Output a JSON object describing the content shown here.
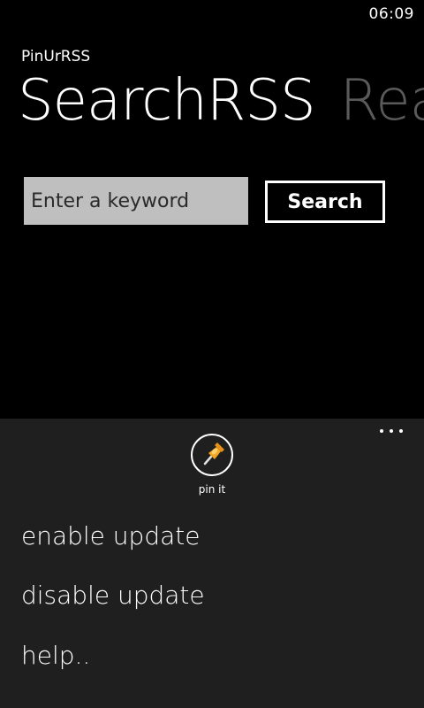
{
  "status_bar": {
    "time": "06:09"
  },
  "app": {
    "title": "PinUrRSS"
  },
  "pivot": {
    "active": "SearchRSS",
    "next": "Rea"
  },
  "search": {
    "placeholder": "Enter a keyword",
    "button_label": "Search"
  },
  "app_bar": {
    "more_icon": "ellipsis-icon",
    "pin_button": {
      "icon": "pushpin-icon",
      "label": "pin it"
    },
    "menu_items": [
      "enable update",
      "disable update",
      "help.."
    ]
  },
  "colors": {
    "background": "#000000",
    "app_bar": "#1f1f1f",
    "input_background": "#bfbfbf",
    "inactive_pivot": "#5a5a5a",
    "pin_accent": "#f5a623"
  }
}
